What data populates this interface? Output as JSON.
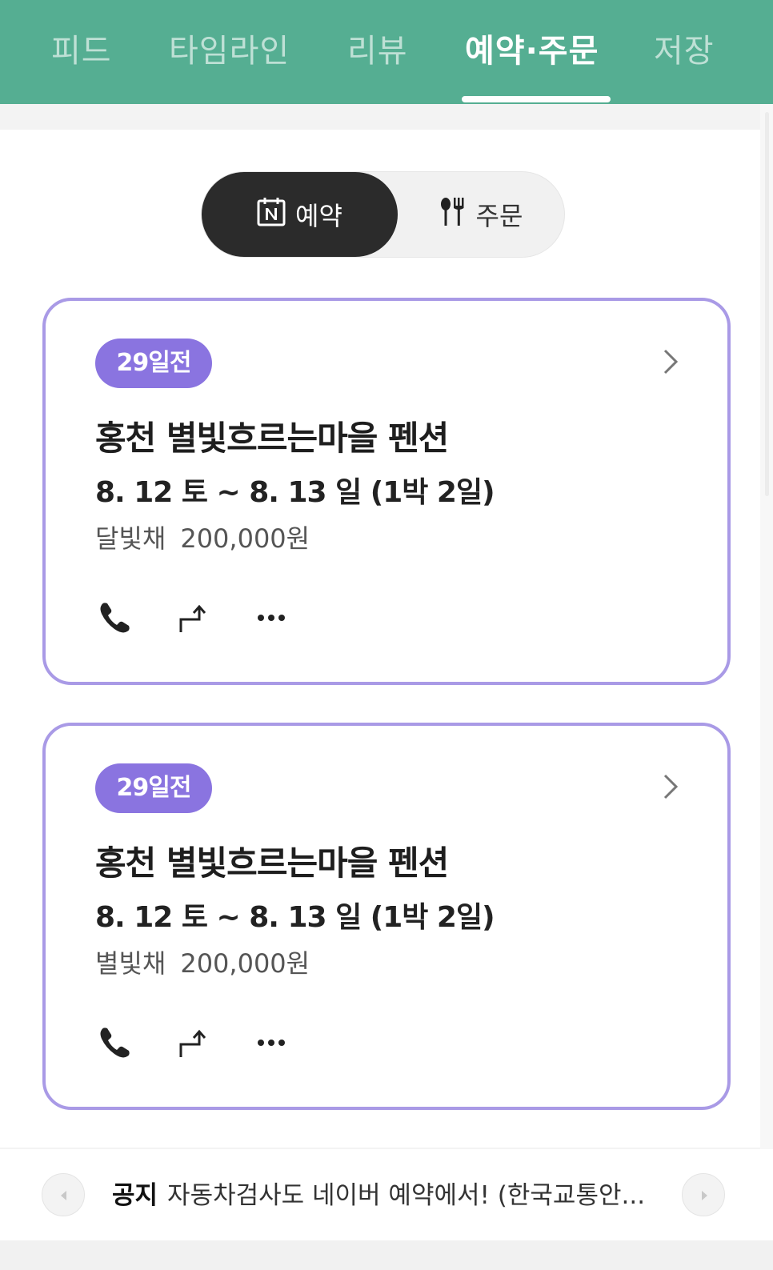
{
  "top_tabs": [
    {
      "label": "피드",
      "active": false
    },
    {
      "label": "타임라인",
      "active": false
    },
    {
      "label": "리뷰",
      "active": false
    },
    {
      "label": "예약·주문",
      "active": true
    },
    {
      "label": "저장",
      "active": false
    }
  ],
  "segment": {
    "reserve_label": "예약",
    "order_label": "주문",
    "reserve_icon": "naver-calendar-icon",
    "order_icon": "utensils-icon",
    "selected": "예약"
  },
  "reservations": [
    {
      "badge": "29일전",
      "title": "홍천 별빛흐르는마을 펜션",
      "date": "8. 12 토 ~ 8. 13 일 (1박 2일)",
      "room": "달빛채",
      "price": "200,000원",
      "actions": [
        "phone-icon",
        "directions-icon",
        "more-icon"
      ]
    },
    {
      "badge": "29일전",
      "title": "홍천 별빛흐르는마을 펜션",
      "date": "8. 12 토 ~ 8. 13 일 (1박 2일)",
      "room": "별빛채",
      "price": "200,000원",
      "actions": [
        "phone-icon",
        "directions-icon",
        "more-icon"
      ]
    }
  ],
  "notice": {
    "label": "공지",
    "text": "자동차검사도 네이버 예약에서! (한국교통안..."
  },
  "colors": {
    "header_bg": "#55ae92",
    "card_border": "#a99ae6",
    "badge_bg": "#8a74e0",
    "segment_active_bg": "#2b2b2b"
  }
}
